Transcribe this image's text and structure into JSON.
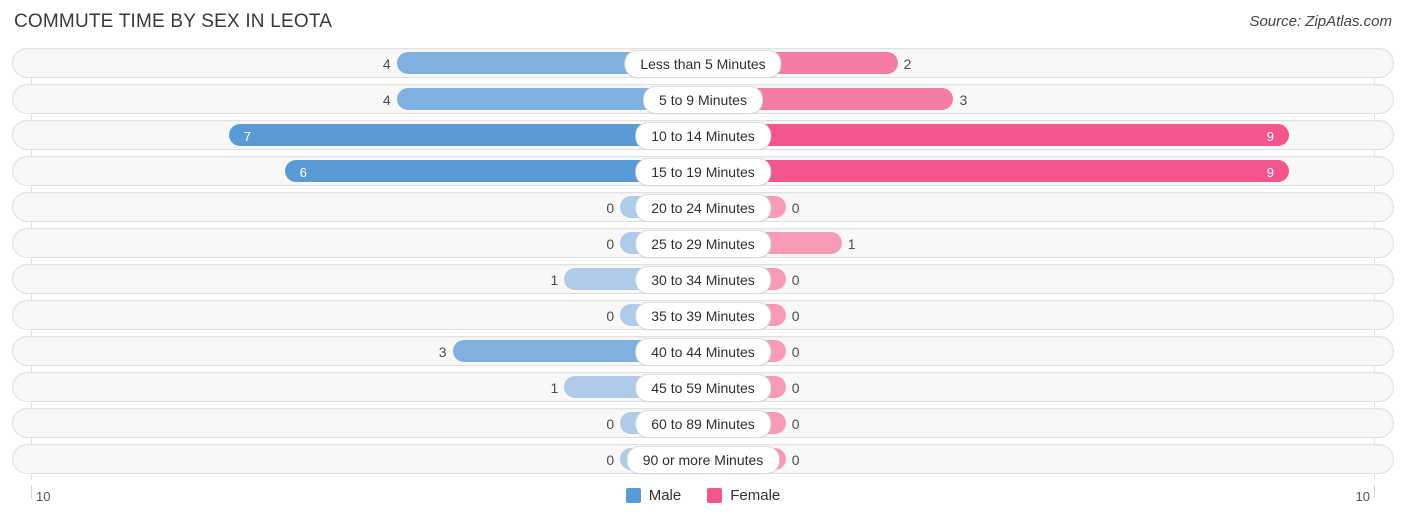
{
  "header": {
    "title": "COMMUTE TIME BY SEX IN LEOTA",
    "source": "Source: ZipAtlas.com"
  },
  "axis": {
    "left_label": "10",
    "right_label": "10"
  },
  "legend": {
    "items": [
      {
        "label": "Male",
        "color": "#5b9bd5"
      },
      {
        "label": "Female",
        "color": "#f4558e"
      }
    ]
  },
  "colors": {
    "male_strong": "#5b9bd5",
    "male_mid": "#7fb0e0",
    "male_light": "#aecbea",
    "female_strong": "#f4558e",
    "female_mid": "#f47ba5",
    "female_light": "#f79ab5",
    "track": "#f8f8f8",
    "track_border": "#e0e0e0",
    "gridline": "#e3e3e3"
  },
  "chart_data": {
    "type": "bar",
    "title": "COMMUTE TIME BY SEX IN LEOTA",
    "subtitle": "",
    "xlabel": "",
    "ylabel": "",
    "orientation": "horizontal-diverging",
    "axis_max": 10,
    "xlim": [
      -10,
      10
    ],
    "grid": true,
    "legend_position": "bottom-center",
    "categories": [
      "Less than 5 Minutes",
      "5 to 9 Minutes",
      "10 to 14 Minutes",
      "15 to 19 Minutes",
      "20 to 24 Minutes",
      "25 to 29 Minutes",
      "30 to 34 Minutes",
      "35 to 39 Minutes",
      "40 to 44 Minutes",
      "45 to 59 Minutes",
      "60 to 89 Minutes",
      "90 or more Minutes"
    ],
    "series": [
      {
        "name": "Male",
        "color": "#5b9bd5",
        "values": [
          4,
          4,
          7,
          6,
          0,
          0,
          1,
          0,
          3,
          1,
          0,
          0
        ]
      },
      {
        "name": "Female",
        "color": "#f4558e",
        "values": [
          2,
          3,
          9,
          9,
          0,
          1,
          0,
          0,
          0,
          0,
          0,
          0
        ]
      }
    ]
  }
}
